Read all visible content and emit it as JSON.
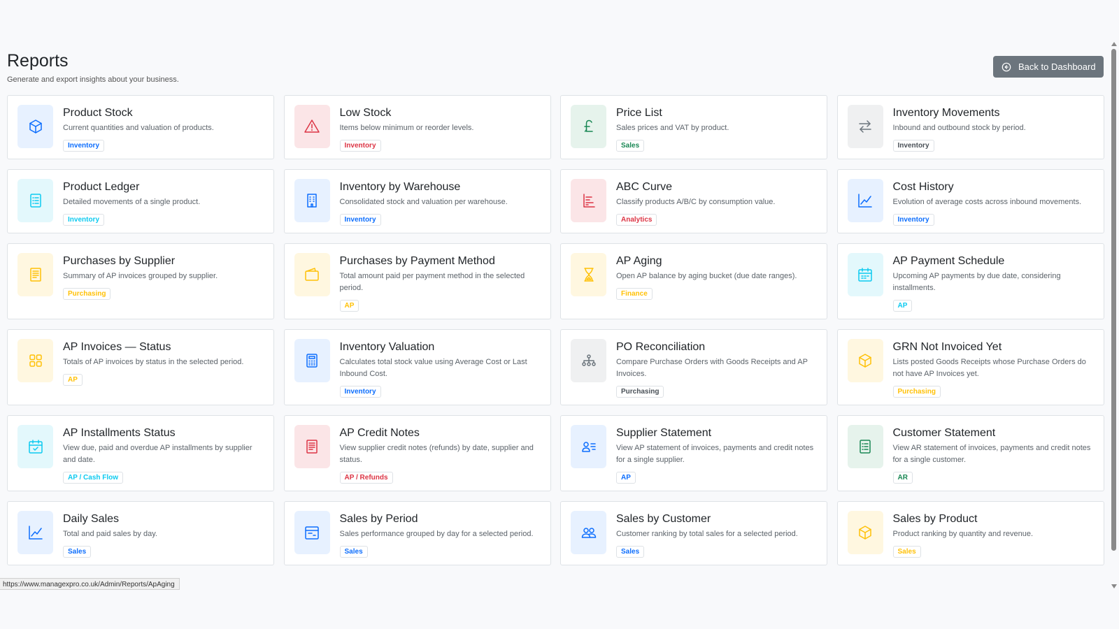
{
  "header": {
    "title": "Reports",
    "subtitle": "Generate and export insights about your business."
  },
  "back_button": {
    "label": "Back to Dashboard"
  },
  "status_url": "https://www.managexpro.co.uk/Admin/Reports/ApAging",
  "colors": {
    "blue": "#0d6efd",
    "red": "#dc3545",
    "green": "#198754",
    "gray": "#6c757d",
    "cyan": "#0dcaf0",
    "yellow": "#ffc107"
  },
  "cards": [
    {
      "title": "Product Stock",
      "desc": "Current quantities and valuation of products.",
      "badge": "Inventory",
      "color": "blue",
      "icon": "box-icon"
    },
    {
      "title": "Low Stock",
      "desc": "Items below minimum or reorder levels.",
      "badge": "Inventory",
      "color": "red",
      "icon": "warning-icon"
    },
    {
      "title": "Price List",
      "desc": "Sales prices and VAT by product.",
      "badge": "Sales",
      "color": "green",
      "icon": "pound-icon"
    },
    {
      "title": "Inventory Movements",
      "desc": "Inbound and outbound stock by period.",
      "badge": "Inventory",
      "color": "gray",
      "icon": "arrows-exchange-icon"
    },
    {
      "title": "Product Ledger",
      "desc": "Detailed movements of a single product.",
      "badge": "Inventory",
      "color": "cyan",
      "icon": "list-document-icon"
    },
    {
      "title": "Inventory by Warehouse",
      "desc": "Consolidated stock and valuation per warehouse.",
      "badge": "Inventory",
      "color": "blue",
      "icon": "building-icon"
    },
    {
      "title": "ABC Curve",
      "desc": "Classify products A/B/C by consumption value.",
      "badge": "Analytics",
      "color": "red",
      "icon": "bar-steps-icon"
    },
    {
      "title": "Cost History",
      "desc": "Evolution of average costs across inbound movements.",
      "badge": "Inventory",
      "color": "blue",
      "icon": "line-chart-icon"
    },
    {
      "title": "Purchases by Supplier",
      "desc": "Summary of AP invoices grouped by supplier.",
      "badge": "Purchasing",
      "color": "yellow",
      "icon": "receipt-icon"
    },
    {
      "title": "Purchases by Payment Method",
      "desc": "Total amount paid per payment method in the selected period.",
      "badge": "AP",
      "color": "yellow",
      "icon": "wallet-icon"
    },
    {
      "title": "AP Aging",
      "desc": "Open AP balance by aging bucket (due date ranges).",
      "badge": "Finance",
      "color": "yellow",
      "icon": "hourglass-icon"
    },
    {
      "title": "AP Payment Schedule",
      "desc": "Upcoming AP payments by due date, considering installments.",
      "badge": "AP",
      "color": "cyan",
      "icon": "calendar-icon"
    },
    {
      "title": "AP Invoices — Status",
      "desc": "Totals of AP invoices by status in the selected period.",
      "badge": "AP",
      "color": "yellow",
      "icon": "grid-squares-icon"
    },
    {
      "title": "Inventory Valuation",
      "desc": "Calculates total stock value using Average Cost or Last Inbound Cost.",
      "badge": "Inventory",
      "color": "blue",
      "icon": "calculator-icon"
    },
    {
      "title": "PO Reconciliation",
      "desc": "Compare Purchase Orders with Goods Receipts and AP Invoices.",
      "badge": "Purchasing",
      "color": "gray",
      "icon": "diagram-icon"
    },
    {
      "title": "GRN Not Invoiced Yet",
      "desc": "Lists posted Goods Receipts whose Purchase Orders do not have AP Invoices yet.",
      "badge": "Purchasing",
      "color": "yellow",
      "icon": "box-icon"
    },
    {
      "title": "AP Installments Status",
      "desc": "View due, paid and overdue AP installments by supplier and date.",
      "badge": "AP / Cash Flow",
      "color": "cyan",
      "icon": "calendar-check-icon"
    },
    {
      "title": "AP Credit Notes",
      "desc": "View supplier credit notes (refunds) by date, supplier and status.",
      "badge": "AP / Refunds",
      "color": "red",
      "icon": "receipt-icon"
    },
    {
      "title": "Supplier Statement",
      "desc": "View AP statement of invoices, payments and credit notes for a single supplier.",
      "badge": "AP",
      "color": "blue",
      "icon": "person-lines-icon"
    },
    {
      "title": "Customer Statement",
      "desc": "View AR statement of invoices, payments and credit notes for a single customer.",
      "badge": "AR",
      "color": "green",
      "icon": "list-document-icon"
    },
    {
      "title": "Daily Sales",
      "desc": "Total and paid sales by day.",
      "badge": "Sales",
      "color": "blue",
      "icon": "line-chart-icon"
    },
    {
      "title": "Sales by Period",
      "desc": "Sales performance grouped by day for a selected period.",
      "badge": "Sales",
      "color": "blue",
      "icon": "calendar-range-icon"
    },
    {
      "title": "Sales by Customer",
      "desc": "Customer ranking by total sales for a selected period.",
      "badge": "Sales",
      "color": "blue",
      "icon": "people-icon"
    },
    {
      "title": "Sales by Product",
      "desc": "Product ranking by quantity and revenue.",
      "badge": "Sales",
      "color": "yellow",
      "icon": "box-icon"
    }
  ]
}
